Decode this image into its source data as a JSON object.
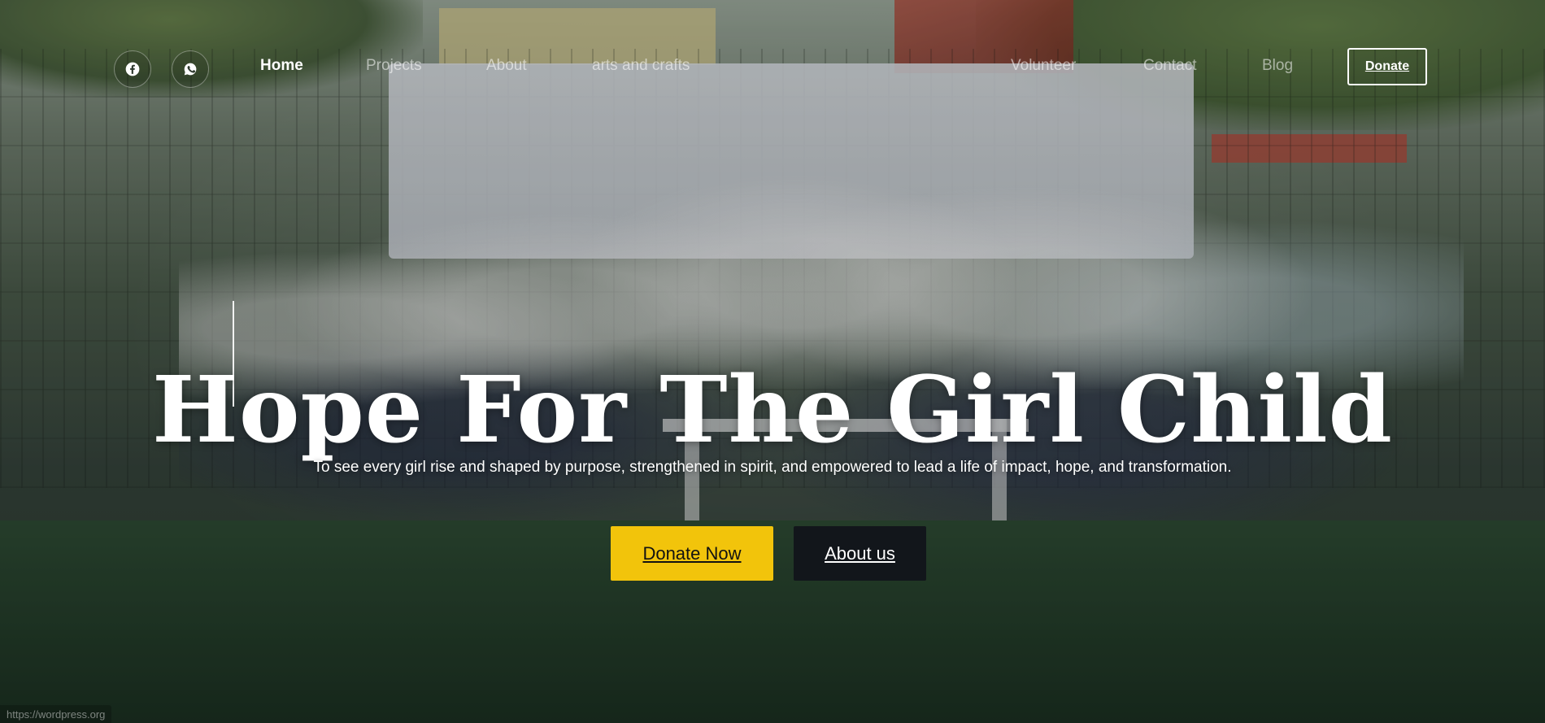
{
  "nav": {
    "social": [
      {
        "icon": "facebook-icon"
      },
      {
        "icon": "whatsapp-icon"
      }
    ],
    "links": {
      "home": "Home",
      "projects": "Projects",
      "about": "About",
      "arts": "arts and crafts",
      "volunteer": "Volunteer",
      "contact": "Contact",
      "blog": "Blog"
    },
    "donate": "Donate"
  },
  "hero": {
    "title": "Hope For The Girl Child",
    "subtitle": "To see every girl rise and shaped by purpose, strengthened in spirit, and empowered to lead a life of impact, hope, and transformation.",
    "buttons": {
      "donate_now": "Donate Now",
      "about_us": "About us"
    }
  },
  "status_url": "https://wordpress.org",
  "colors": {
    "accent": "#f2c40b",
    "dark_button": "#12161b",
    "text": "#ffffff"
  }
}
